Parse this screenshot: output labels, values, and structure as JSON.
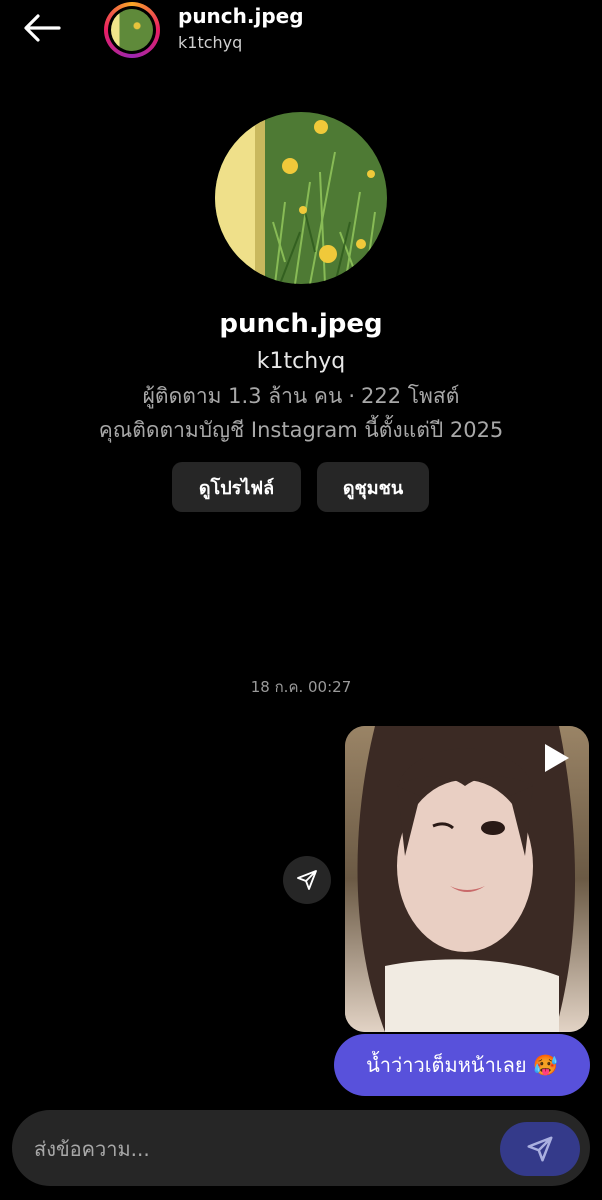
{
  "header": {
    "name": "punch.jpeg",
    "handle": "k1tchyq"
  },
  "profile": {
    "name": "punch.jpeg",
    "handle": "k1tchyq",
    "followers": "ผู้ติดตาม 1.3 ล้าน คน",
    "separator": "·",
    "posts": "222 โพสต์",
    "follow_since": "คุณติดตามบัญชี Instagram นี้ตั้งแต่ปี 2025",
    "view_profile_label": "ดูโปรไฟล์",
    "view_community_label": "ดูชุมชน"
  },
  "chat": {
    "timestamp": "18 ก.ค. 00:27",
    "message_text": "น้ำว่าวเต็มหน้าเลย 🥵"
  },
  "composer": {
    "placeholder": "ส่งข้อความ..."
  },
  "colors": {
    "background": "#000000",
    "bubble": "#5851db",
    "send_button": "#343a8a",
    "surface": "#262626"
  },
  "icons": {
    "back": "arrow-left-icon",
    "play": "play-icon",
    "share": "paper-plane-icon",
    "send": "send-icon"
  }
}
